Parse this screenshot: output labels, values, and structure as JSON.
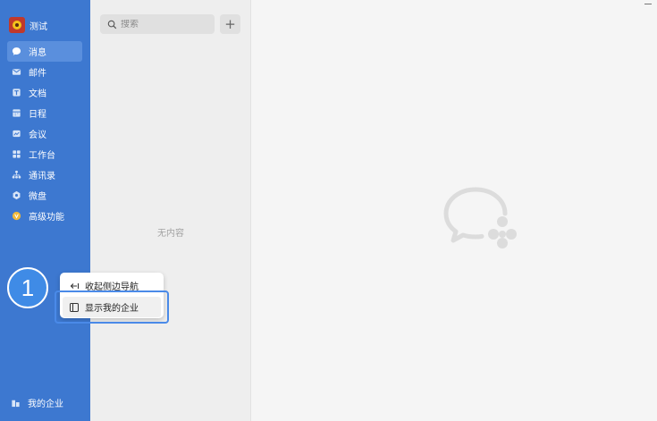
{
  "user": {
    "name": "测试"
  },
  "nav": [
    {
      "label": "消息",
      "icon": "chat-icon",
      "active": true
    },
    {
      "label": "邮件",
      "icon": "mail-icon"
    },
    {
      "label": "文档",
      "icon": "document-icon"
    },
    {
      "label": "日程",
      "icon": "calendar-icon"
    },
    {
      "label": "会议",
      "icon": "meeting-icon"
    },
    {
      "label": "工作台",
      "icon": "workbench-icon"
    },
    {
      "label": "通讯录",
      "icon": "contacts-icon"
    },
    {
      "label": "微盘",
      "icon": "drive-icon"
    },
    {
      "label": "高级功能",
      "icon": "advanced-icon"
    }
  ],
  "bottom_nav": {
    "label": "我的企业",
    "icon": "enterprise-icon"
  },
  "search": {
    "placeholder": "搜索"
  },
  "list": {
    "empty_text": "无内容"
  },
  "popup": {
    "items": [
      {
        "label": "收起侧边导航",
        "icon": "collapse-icon"
      },
      {
        "label": "显示我的企业",
        "icon": "panel-icon"
      }
    ]
  },
  "step_badge": "1",
  "colors": {
    "sidebar": "#3d78d0",
    "active_item": "#5a8fdd",
    "highlight": "#4a8ae8",
    "badge": "#3f8be6"
  }
}
